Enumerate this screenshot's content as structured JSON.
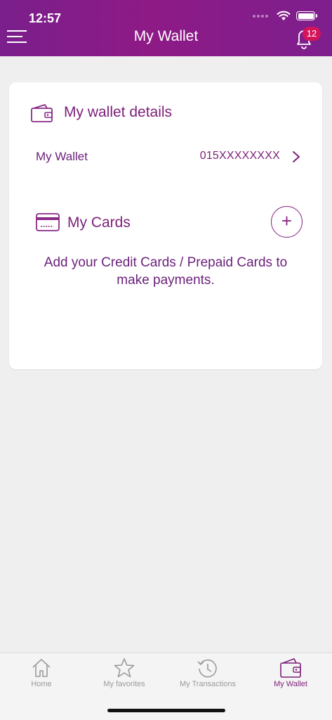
{
  "status_bar": {
    "time": "12:57"
  },
  "header": {
    "title": "My Wallet",
    "notification_count": "12"
  },
  "wallet_section": {
    "title": "My wallet details",
    "row_label": "My Wallet",
    "row_value": "015XXXXXXXX"
  },
  "cards_section": {
    "title": "My Cards",
    "add_label": "+",
    "empty_text": "Add your Credit Cards / Prepaid Cards to make payments."
  },
  "tabs": [
    {
      "label": "Home",
      "icon": "home-icon",
      "active": false
    },
    {
      "label": "My favorites",
      "icon": "star-icon",
      "active": false
    },
    {
      "label": "My Transactions",
      "icon": "history-icon",
      "active": false
    },
    {
      "label": "My Wallet",
      "icon": "wallet-icon",
      "active": true
    }
  ],
  "colors": {
    "brand": "#7d1f79",
    "header": "#8e1a86",
    "badge": "#d4145a",
    "background": "#efefef"
  }
}
